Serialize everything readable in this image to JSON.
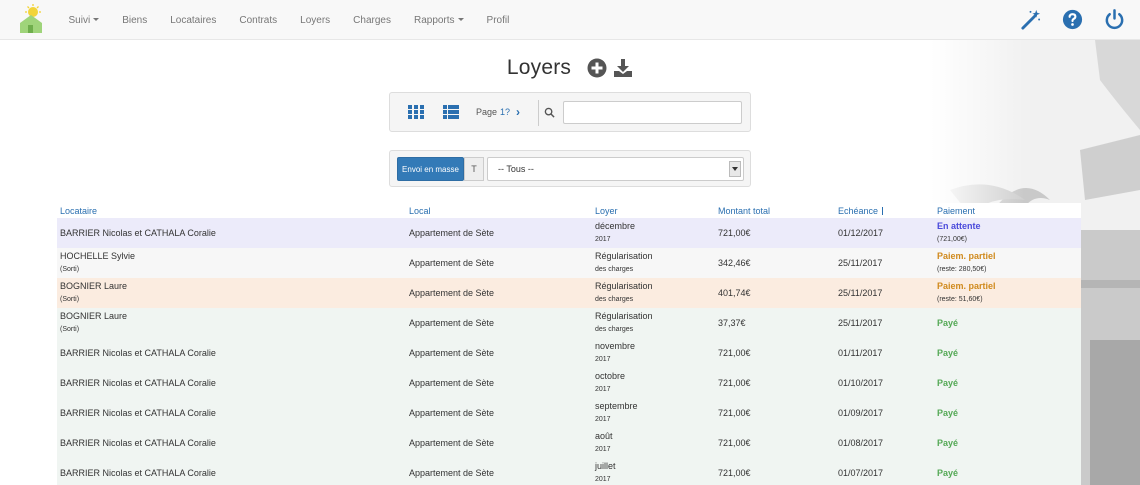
{
  "colors": {
    "accent": "#337ab7",
    "link": "#2a6fb0",
    "paid": "#54a855",
    "partial": "#d08a1d",
    "waiting": "#4a4adb"
  },
  "nav": {
    "logo": "sun-house-logo",
    "items": [
      {
        "label": "Suivi",
        "dropdown": true
      },
      {
        "label": "Biens"
      },
      {
        "label": "Locataires"
      },
      {
        "label": "Contrats"
      },
      {
        "label": "Loyers"
      },
      {
        "label": "Charges"
      },
      {
        "label": "Rapports",
        "dropdown": true
      },
      {
        "label": "Profil"
      }
    ],
    "right_icons": [
      "magic-wand-icon",
      "help-icon",
      "power-icon"
    ]
  },
  "page": {
    "title": "Loyers",
    "actions": [
      "add-circle-icon",
      "download-icon"
    ]
  },
  "view_bar": {
    "views": [
      "grid-view-icon",
      "list-view-icon"
    ],
    "page_label": "Page",
    "page_value": "1?",
    "search_placeholder": ""
  },
  "filter_bar": {
    "bulk_button": "Envoi en masse",
    "filter_icon": "T",
    "status_value": "-- Tous --"
  },
  "table": {
    "headers": [
      "Locataire",
      "Local",
      "Loyer",
      "Montant total",
      "Echéance",
      "Paiement"
    ],
    "rows": [
      {
        "tenant": "BARRIER Nicolas et CATHALA Coralie",
        "tenant_note": "",
        "local": "Appartement de Sète",
        "loyer": [
          "décembre",
          "2017"
        ],
        "montant": "721,00€",
        "echeance": "01/12/2017",
        "status": "En attente",
        "status_note": "(721,00€)",
        "kind": "wait"
      },
      {
        "tenant": "HOCHELLE Sylvie",
        "tenant_note": "(Sorti)",
        "local": "Appartement de Sète",
        "loyer": [
          "Régularisation",
          "des charges"
        ],
        "montant": "342,46€",
        "echeance": "25/11/2017",
        "status": "Paiem. partiel",
        "status_note": "(reste: 280,50€)",
        "kind": "part"
      },
      {
        "tenant": "BOGNIER Laure",
        "tenant_note": "(Sorti)",
        "local": "Appartement de Sète",
        "loyer": [
          "Régularisation",
          "des charges"
        ],
        "montant": "401,74€",
        "echeance": "25/11/2017",
        "status": "Paiem. partiel",
        "status_note": "(reste: 51,60€)",
        "kind": "part2"
      },
      {
        "tenant": "BOGNIER Laure",
        "tenant_note": "(Sorti)",
        "local": "Appartement de Sète",
        "loyer": [
          "Régularisation",
          "des charges"
        ],
        "montant": "37,37€",
        "echeance": "25/11/2017",
        "status": "Payé",
        "status_note": "",
        "kind": "paid"
      },
      {
        "tenant": "BARRIER Nicolas et CATHALA Coralie",
        "tenant_note": "",
        "local": "Appartement de Sète",
        "loyer": [
          "novembre",
          "2017"
        ],
        "montant": "721,00€",
        "echeance": "01/11/2017",
        "status": "Payé",
        "status_note": "",
        "kind": "paid"
      },
      {
        "tenant": "BARRIER Nicolas et CATHALA Coralie",
        "tenant_note": "",
        "local": "Appartement de Sète",
        "loyer": [
          "octobre",
          "2017"
        ],
        "montant": "721,00€",
        "echeance": "01/10/2017",
        "status": "Payé",
        "status_note": "",
        "kind": "paid"
      },
      {
        "tenant": "BARRIER Nicolas et CATHALA Coralie",
        "tenant_note": "",
        "local": "Appartement de Sète",
        "loyer": [
          "septembre",
          "2017"
        ],
        "montant": "721,00€",
        "echeance": "01/09/2017",
        "status": "Payé",
        "status_note": "",
        "kind": "paid"
      },
      {
        "tenant": "BARRIER Nicolas et CATHALA Coralie",
        "tenant_note": "",
        "local": "Appartement de Sète",
        "loyer": [
          "août",
          "2017"
        ],
        "montant": "721,00€",
        "echeance": "01/08/2017",
        "status": "Payé",
        "status_note": "",
        "kind": "paid"
      },
      {
        "tenant": "BARRIER Nicolas et CATHALA Coralie",
        "tenant_note": "",
        "local": "Appartement de Sète",
        "loyer": [
          "juillet",
          "2017"
        ],
        "montant": "721,00€",
        "echeance": "01/07/2017",
        "status": "Payé",
        "status_note": "",
        "kind": "paid"
      }
    ]
  }
}
